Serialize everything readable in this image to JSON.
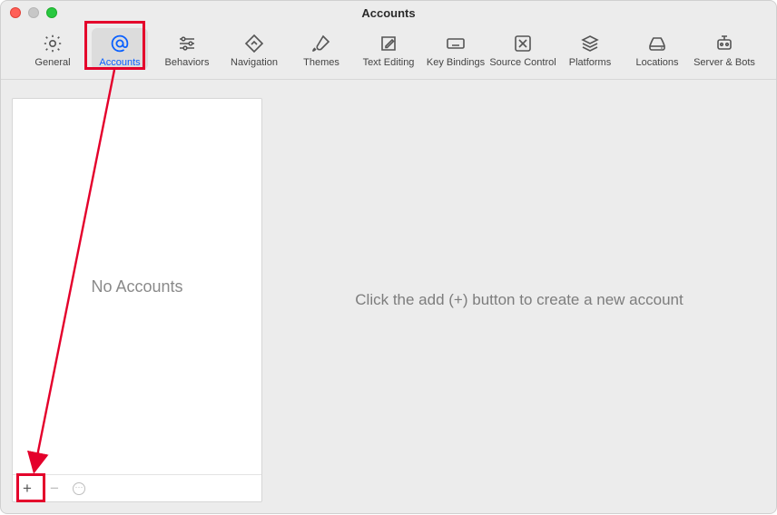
{
  "window": {
    "title": "Accounts"
  },
  "toolbar": {
    "items": [
      {
        "id": "general",
        "label": "General"
      },
      {
        "id": "accounts",
        "label": "Accounts"
      },
      {
        "id": "behaviors",
        "label": "Behaviors"
      },
      {
        "id": "navigation",
        "label": "Navigation"
      },
      {
        "id": "themes",
        "label": "Themes"
      },
      {
        "id": "text-editing",
        "label": "Text Editing"
      },
      {
        "id": "key-bindings",
        "label": "Key Bindings"
      },
      {
        "id": "source-control",
        "label": "Source Control"
      },
      {
        "id": "platforms",
        "label": "Platforms"
      },
      {
        "id": "locations",
        "label": "Locations"
      },
      {
        "id": "server-bots",
        "label": "Server & Bots"
      }
    ],
    "selected": "accounts"
  },
  "sidebar": {
    "empty_text": "No Accounts",
    "footer": {
      "add": "+",
      "remove": "−",
      "settings": "settings"
    }
  },
  "detail": {
    "empty_text": "Click the add (+) button to create a new account"
  },
  "annotation": {
    "highlight_accounts": true,
    "highlight_add": true,
    "color": "#e4002b"
  }
}
